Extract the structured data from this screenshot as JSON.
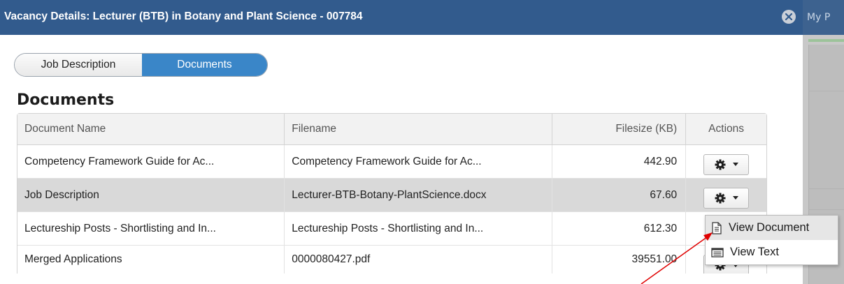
{
  "background_app": {
    "title_fragment": "My P"
  },
  "dialog": {
    "title": "Vacancy Details: Lecturer (BTB) in Botany and Plant Science - 007784",
    "close_icon": "close-circle-icon"
  },
  "tabs": [
    {
      "label": "Job Description",
      "active": false
    },
    {
      "label": "Documents",
      "active": true
    }
  ],
  "section_title": "Documents",
  "table": {
    "headers": {
      "document_name": "Document Name",
      "filename": "Filename",
      "filesize": "Filesize (KB)",
      "actions": "Actions"
    },
    "rows": [
      {
        "document_name": "Competency Framework Guide for Ac...",
        "filename": "Competency Framework Guide for Ac...",
        "filesize": "442.90",
        "selected": false
      },
      {
        "document_name": "Job Description",
        "filename": "Lecturer-BTB-Botany-PlantScience.docx",
        "filesize": "67.60",
        "selected": true
      },
      {
        "document_name": "Lectureship Posts - Shortlisting and In...",
        "filename": "Lectureship Posts - Shortlisting and In...",
        "filesize": "612.30",
        "selected": false
      },
      {
        "document_name": "Merged Applications",
        "filename": "0000080427.pdf",
        "filesize": "39551.00",
        "selected": false
      }
    ]
  },
  "actions_menu": {
    "items": [
      {
        "label": "View Document",
        "icon": "document-icon",
        "highlighted": true
      },
      {
        "label": "View Text",
        "icon": "text-list-icon",
        "highlighted": false
      }
    ]
  },
  "colors": {
    "titlebar": "#325b8d",
    "active_tab": "#3a86c8",
    "selected_row": "#d9d9d9",
    "annotation_arrow": "#e00000"
  }
}
